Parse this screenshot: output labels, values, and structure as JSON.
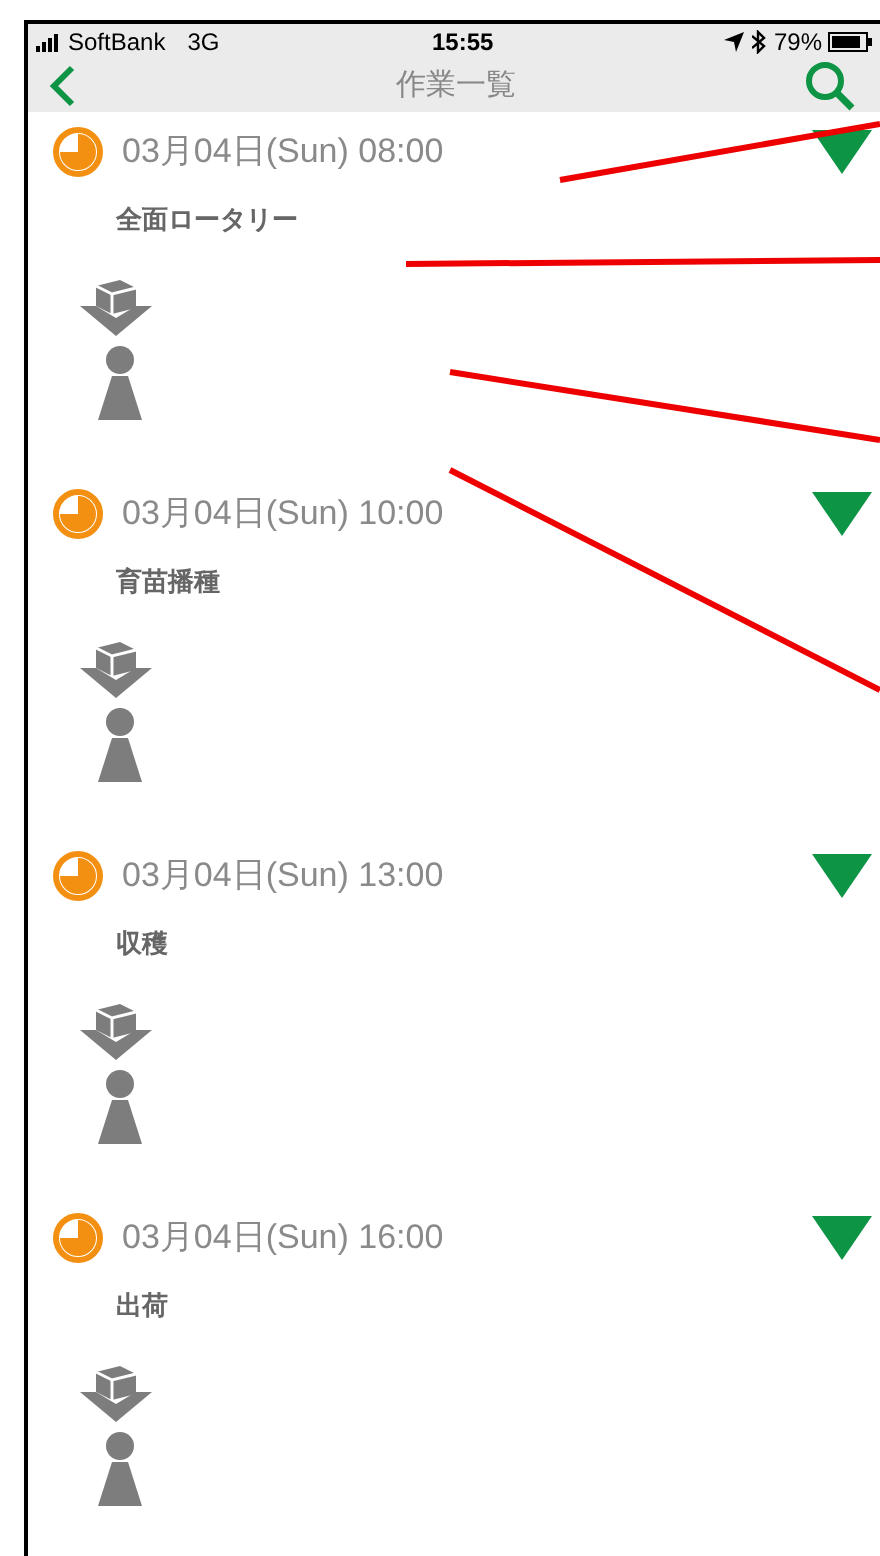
{
  "status_bar": {
    "carrier": "SoftBank",
    "network": "3G",
    "time": "15:55",
    "battery": "79%"
  },
  "nav": {
    "title": "作業一覧"
  },
  "tasks": [
    {
      "datetime": "03月04日(Sun) 08:00",
      "name": "全面ロータリー"
    },
    {
      "datetime": "03月04日(Sun) 10:00",
      "name": "育苗播種"
    },
    {
      "datetime": "03月04日(Sun) 13:00",
      "name": "収穫"
    },
    {
      "datetime": "03月04日(Sun) 16:00",
      "name": "出荷"
    }
  ]
}
